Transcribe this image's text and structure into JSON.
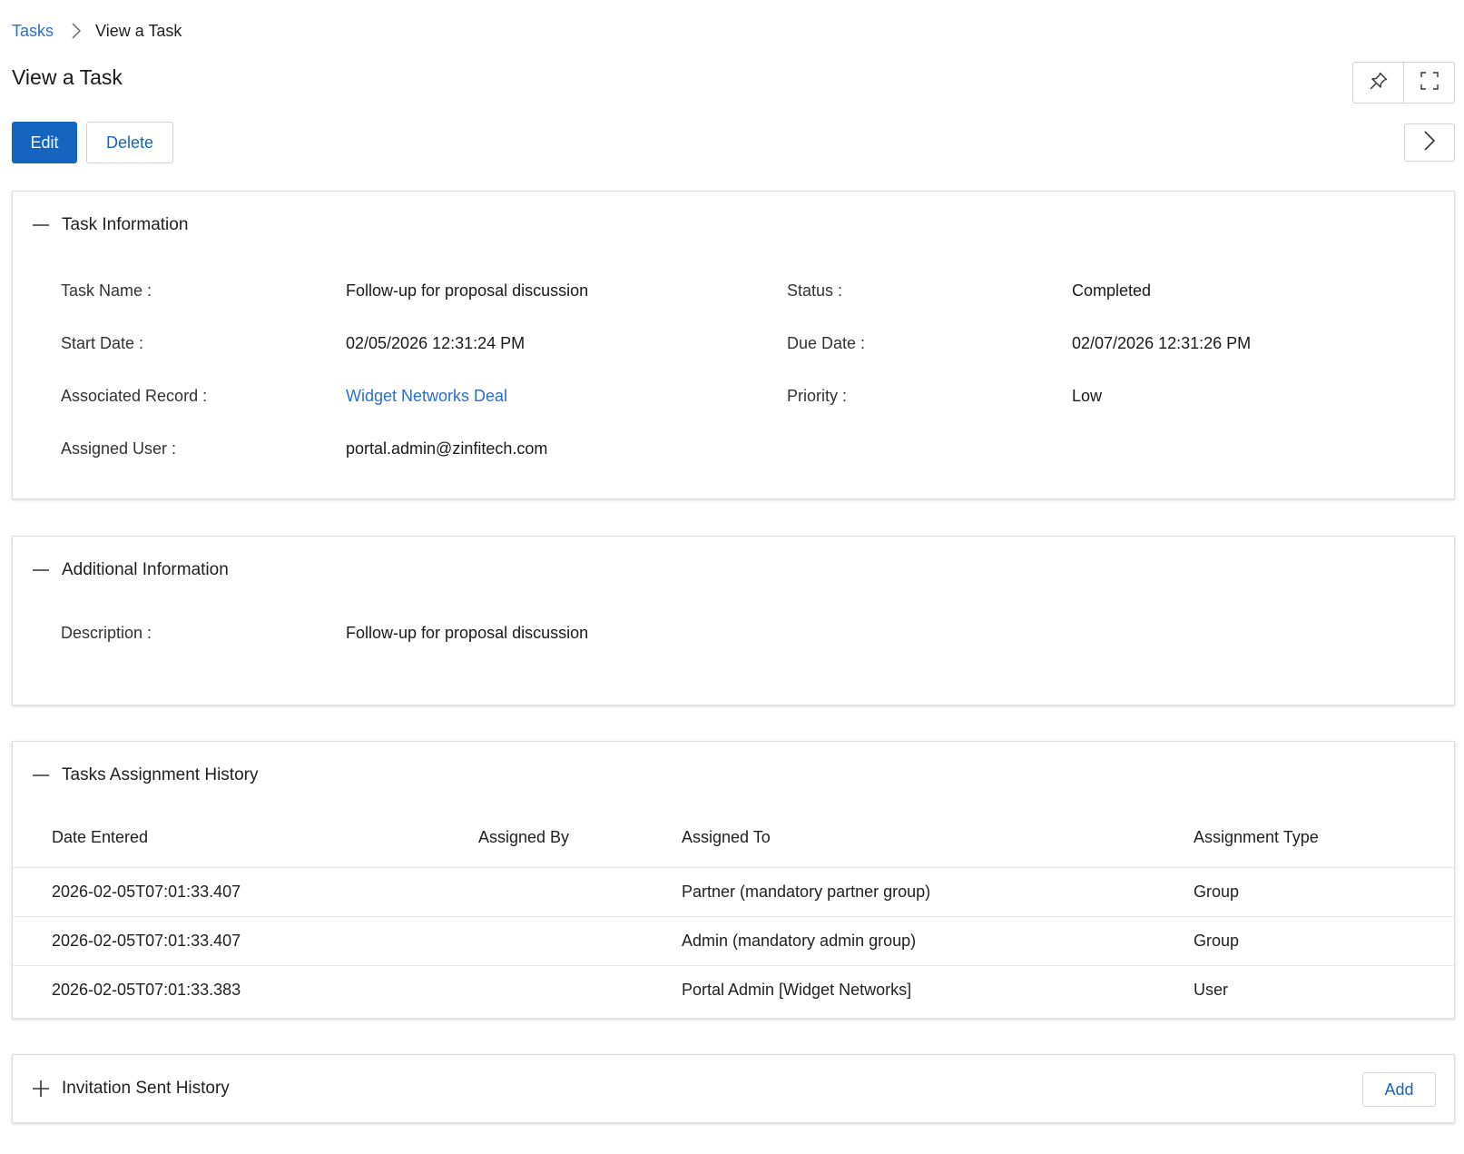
{
  "breadcrumb": {
    "parent": "Tasks",
    "current": "View a Task"
  },
  "page_title": "View a Task",
  "toolbar": {
    "edit_label": "Edit",
    "delete_label": "Delete"
  },
  "task_information": {
    "title": "Task Information",
    "task_name_label": "Task Name :",
    "task_name": "Follow-up for proposal discussion",
    "status_label": "Status :",
    "status": "Completed",
    "start_date_label": "Start Date :",
    "start_date": "02/05/2026 12:31:24 PM",
    "due_date_label": "Due Date :",
    "due_date": "02/07/2026 12:31:26 PM",
    "associated_record_label": "Associated Record :",
    "associated_record": "Widget Networks Deal",
    "priority_label": "Priority :",
    "priority": "Low",
    "assigned_user_label": "Assigned User :",
    "assigned_user": "portal.admin@zinfitech.com"
  },
  "additional_information": {
    "title": "Additional Information",
    "description_label": "Description :",
    "description": "Follow-up for proposal discussion"
  },
  "assignment_history": {
    "title": "Tasks Assignment History",
    "columns": [
      "Date Entered",
      "Assigned By",
      "Assigned To",
      "Assignment Type"
    ],
    "rows": [
      {
        "date_entered": "2026-02-05T07:01:33.407",
        "assigned_by": "",
        "assigned_to": "Partner (mandatory partner group)",
        "assignment_type": "Group"
      },
      {
        "date_entered": "2026-02-05T07:01:33.407",
        "assigned_by": "",
        "assigned_to": "Admin (mandatory admin group)",
        "assignment_type": "Group"
      },
      {
        "date_entered": "2026-02-05T07:01:33.383",
        "assigned_by": "",
        "assigned_to": "Portal Admin [Widget Networks]",
        "assignment_type": "User"
      }
    ]
  },
  "invitation_history": {
    "title": "Invitation Sent History",
    "add_label": "Add"
  },
  "icons": {
    "breadcrumb_separator": "chevron-right-icon",
    "pin": "pin-icon",
    "fullscreen": "fullscreen-icon",
    "next": "chevron-right-icon",
    "collapse": "minus-icon",
    "expand": "plus-icon"
  },
  "colors": {
    "primary": "#1565c0",
    "link": "#2a6fc9",
    "border": "#cfd3d8"
  }
}
